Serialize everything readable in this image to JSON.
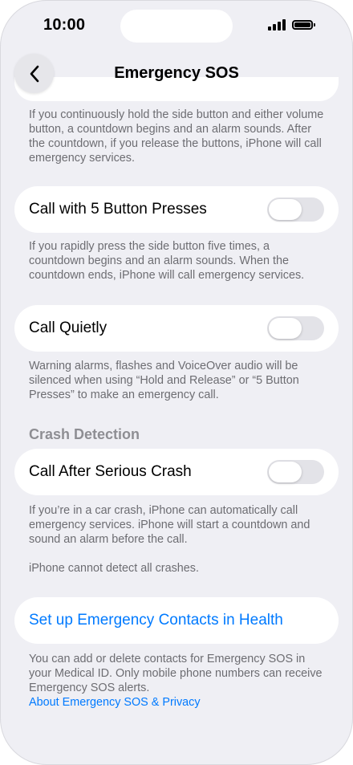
{
  "status_bar": {
    "time": "10:00"
  },
  "nav": {
    "title": "Emergency SOS"
  },
  "hold_release_footer": "If you continuously hold the side button and either volume button, a countdown begins and an alarm sounds. After the countdown, if you release the buttons, iPhone will call emergency services.",
  "five_press": {
    "label": "Call with 5 Button Presses",
    "enabled": false,
    "footer": "If you rapidly press the side button five times, a countdown begins and an alarm sounds. When the countdown ends, iPhone will call emergency services."
  },
  "call_quietly": {
    "label": "Call Quietly",
    "enabled": false,
    "footer": "Warning alarms, flashes and VoiceOver audio will be silenced when using “Hold and Release” or “5 Button Presses” to make an emergency call."
  },
  "crash_detection": {
    "header": "Crash Detection",
    "label": "Call After Serious Crash",
    "enabled": false,
    "footer": "If you’re in a car crash, iPhone can automatically call emergency services. iPhone will start a countdown and sound an alarm before the call.",
    "footer_note": "iPhone cannot detect all crashes."
  },
  "contacts": {
    "link_label": "Set up Emergency Contacts in Health",
    "footer": "You can add or delete contacts for Emergency SOS in your Medical ID. Only mobile phone numbers can receive Emergency SOS alerts.",
    "privacy_link": "About Emergency SOS & Privacy"
  },
  "colors": {
    "accent": "#007aff",
    "background": "#efeff4",
    "toggle_off": "#e3e3e8",
    "secondary_text": "#6d6d72"
  }
}
